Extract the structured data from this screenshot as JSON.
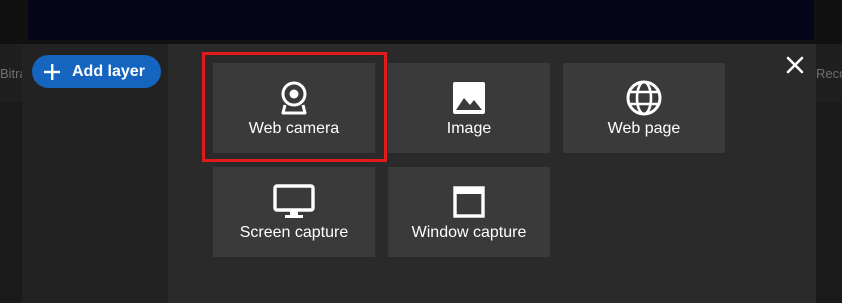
{
  "background": {
    "left_text": "Bitrate",
    "right_text": "Recording"
  },
  "modal": {
    "add_layer_label": "Add layer",
    "close_icon": "close-icon",
    "tiles": [
      {
        "label": "Web camera",
        "icon": "webcam-icon",
        "highlighted": true
      },
      {
        "label": "Image",
        "icon": "image-icon"
      },
      {
        "label": "Web page",
        "icon": "globe-icon"
      },
      {
        "label": "Screen capture",
        "icon": "monitor-icon"
      },
      {
        "label": "Window capture",
        "icon": "window-icon"
      }
    ]
  },
  "colors": {
    "accent": "#1565c0",
    "highlight": "#e01b1b",
    "tile_bg": "#3a3a3a"
  }
}
